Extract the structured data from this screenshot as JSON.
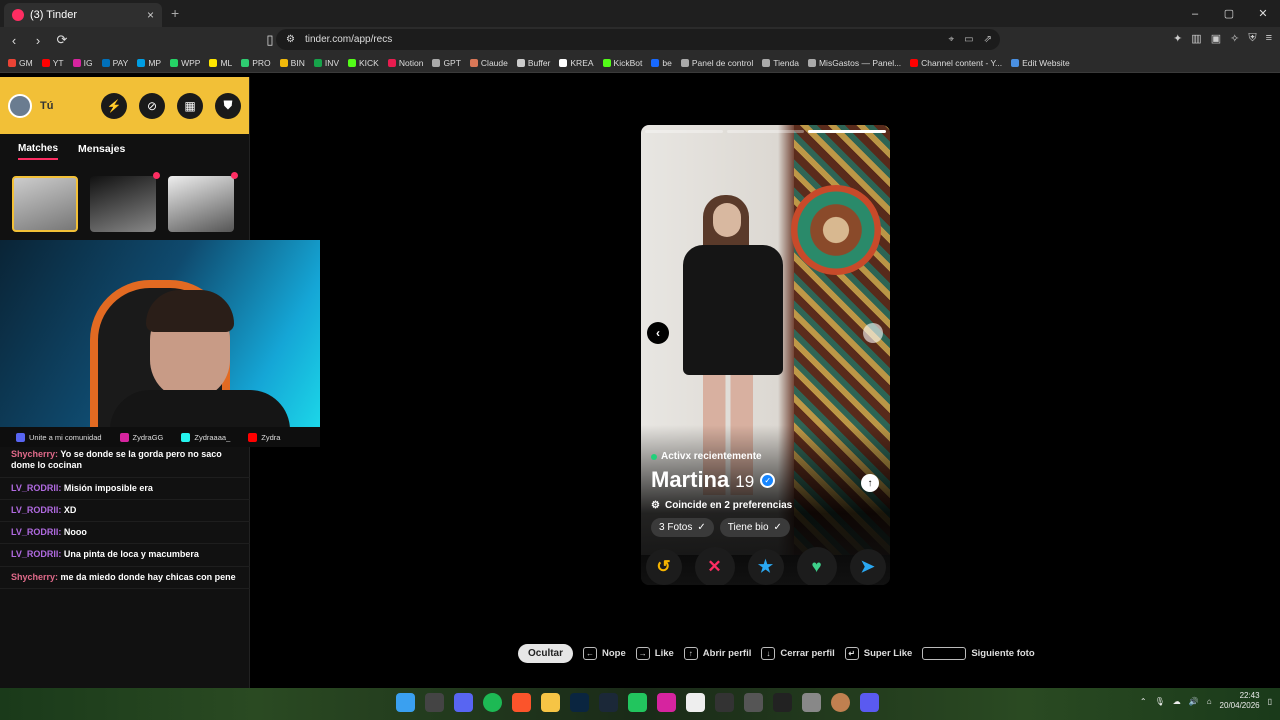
{
  "browser": {
    "tab_title": "(3) Tinder",
    "tab_close": "×",
    "new_tab": "+",
    "url": "tinder.com/app/recs",
    "window": {
      "minimize": "–",
      "maximize": "▢",
      "close": "✕"
    }
  },
  "bookmarks": [
    {
      "label": "GM",
      "color": "#ea4335"
    },
    {
      "label": "YT",
      "color": "#ff0000"
    },
    {
      "label": "IG",
      "color": "#d6249f"
    },
    {
      "label": "PAY",
      "color": "#0070ba"
    },
    {
      "label": "MP",
      "color": "#009ee3"
    },
    {
      "label": "WPP",
      "color": "#25d366"
    },
    {
      "label": "ML",
      "color": "#ffe600"
    },
    {
      "label": "PRO",
      "color": "#2ecc71"
    },
    {
      "label": "BIN",
      "color": "#f0b90b"
    },
    {
      "label": "INV",
      "color": "#16a34a"
    },
    {
      "label": "KICK",
      "color": "#53fc18"
    },
    {
      "label": "Notion",
      "color": "#e81c4f"
    },
    {
      "label": "GPT",
      "color": "#aaaaaa"
    },
    {
      "label": "Claude",
      "color": "#d97757"
    },
    {
      "label": "Buffer",
      "color": "#cccccc"
    },
    {
      "label": "KREA",
      "color": "#ffffff"
    },
    {
      "label": "KickBot",
      "color": "#53fc18"
    },
    {
      "label": "be",
      "color": "#1769ff"
    },
    {
      "label": "Panel de control",
      "color": "#aaaaaa"
    },
    {
      "label": "Tienda",
      "color": "#aaaaaa"
    },
    {
      "label": "MisGastos — Panel...",
      "color": "#aaaaaa"
    },
    {
      "label": "Channel content - Y...",
      "color": "#ff0000"
    },
    {
      "label": "Edit Website",
      "color": "#4a90e2"
    }
  ],
  "sidebar": {
    "user_label": "Tú",
    "tabs": [
      {
        "label": "Matches",
        "active": true
      },
      {
        "label": "Mensajes",
        "active": false
      }
    ],
    "header_icons": [
      "boost-icon",
      "explore-icon",
      "briefcase-icon",
      "shield-icon"
    ]
  },
  "stream": {
    "socials": [
      {
        "label": "Unite a mi comunidad",
        "icon": "discord-icon",
        "color": "#5865f2"
      },
      {
        "label": "ZydraGG",
        "icon": "instagram-icon",
        "color": "#d6249f"
      },
      {
        "label": "Zydraaaa_",
        "icon": "tiktok-icon",
        "color": "#25f4ee"
      },
      {
        "label": "Zydra",
        "icon": "youtube-icon",
        "color": "#ff0000"
      }
    ],
    "chat": [
      {
        "user": "Shycherry:",
        "text": "Yo se donde se la gorda pero no saco dome lo cocinan",
        "pink": true
      },
      {
        "user": "LV_RODRII:",
        "text": "Misión imposible era",
        "pink": false
      },
      {
        "user": "LV_RODRII:",
        "text": "XD",
        "pink": false
      },
      {
        "user": "LV_RODRII:",
        "text": "Nooo",
        "pink": false
      },
      {
        "user": "LV_RODRII:",
        "text": "Una pinta de loca y macumbera",
        "pink": false
      },
      {
        "user": "Shycherry:",
        "text": "me da miedo donde hay chicas con pene",
        "pink": true
      }
    ]
  },
  "profile": {
    "status": "Activx recientemente",
    "name": "Martina",
    "age": "19",
    "preferences": "Coincide en 2 preferencias",
    "chips": [
      {
        "label": "3 Fotos",
        "check": "✓"
      },
      {
        "label": "Tiene bio",
        "check": "✓"
      }
    ],
    "photo_count": 3,
    "current_photo": 3
  },
  "actions": {
    "rewind": "↺",
    "nope": "✕",
    "super_like": "★",
    "like": "♥",
    "boost": "➤"
  },
  "shortcuts": {
    "hide": "Ocultar",
    "items": [
      {
        "key": "←",
        "label": "Nope"
      },
      {
        "key": "→",
        "label": "Like"
      },
      {
        "key": "↑",
        "label": "Abrir perfil"
      },
      {
        "key": "↓",
        "label": "Cerrar perfil"
      },
      {
        "key": "↵",
        "label": "Super Like"
      },
      {
        "key": "",
        "label": "Siguiente foto"
      }
    ]
  },
  "taskbar": {
    "time": "22:43",
    "date": "20/04/2026"
  }
}
